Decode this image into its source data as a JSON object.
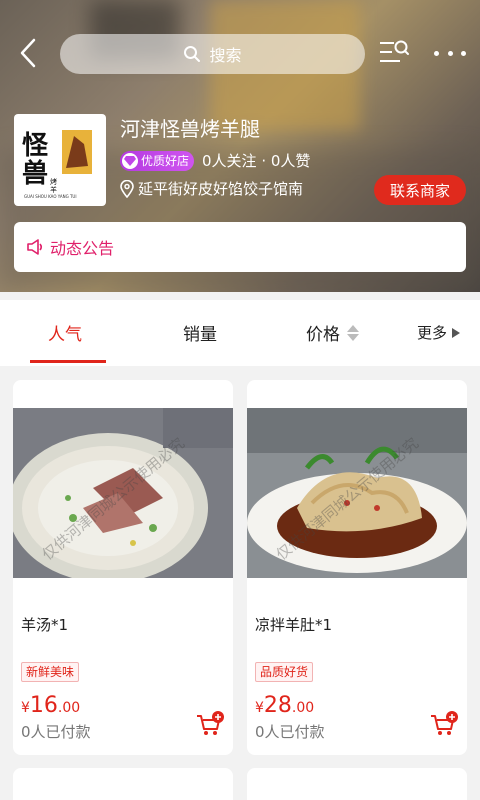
{
  "header": {
    "search_placeholder": "搜索"
  },
  "shop": {
    "name": "河津怪兽烤羊腿",
    "logo_text_main": "怪兽",
    "logo_text_side": "烤羊腿",
    "logo_text_pinyin": "GUAI SHOU KAO YANG TUI",
    "badge": "优质好店",
    "follow_stats": "0人关注 · 0人赞",
    "location": "延平街好皮好馅饺子馆南",
    "contact_label": "联系商家",
    "notice_label": "动态公告"
  },
  "tabs": {
    "popularity": "人气",
    "sales": "销量",
    "price": "价格",
    "more": "更多"
  },
  "products": [
    {
      "name": "羊汤*1",
      "tag": "新鲜美味",
      "price_symbol": "¥",
      "price_int": "16",
      "price_dec": ".00",
      "paid": "0人已付款",
      "watermark": "仅供河津同城公示使用必究"
    },
    {
      "name": "凉拌羊肚*1",
      "tag": "品质好货",
      "price_symbol": "¥",
      "price_int": "28",
      "price_dec": ".00",
      "paid": "0人已付款",
      "watermark": "仅供河津同城公示使用必究"
    }
  ],
  "colors": {
    "accent_red": "#e0251b",
    "notice_pink": "#e0206a",
    "badge_purple": "#c046e8"
  },
  "icons": {
    "back": "chevron-left-icon",
    "search": "search-icon",
    "category": "category-list-icon",
    "more": "more-dots-icon",
    "badge": "diamond-icon",
    "location": "location-pin-icon",
    "notice": "megaphone-icon",
    "sort": "sort-arrows-icon",
    "more_tab": "triangle-right-icon",
    "cart": "add-to-cart-icon"
  }
}
